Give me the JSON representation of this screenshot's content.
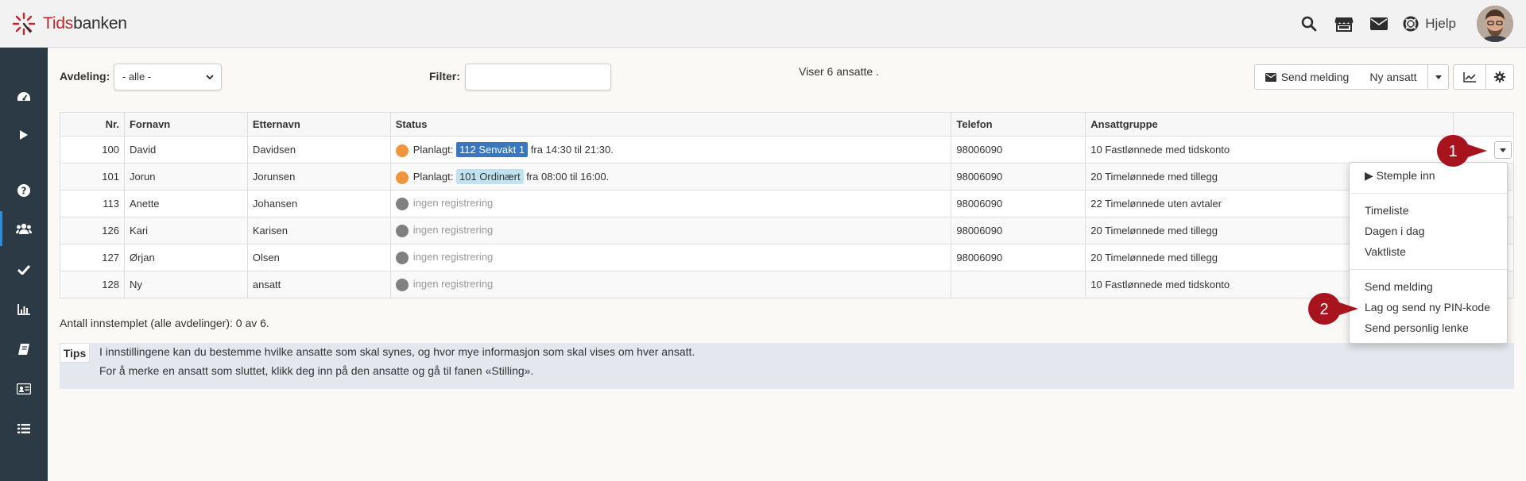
{
  "app": {
    "logo_part1": "Tids",
    "logo_part2": "banken",
    "help_label": "Hjelp"
  },
  "sidebar": {
    "items": [
      "dashboard-icon",
      "play-icon",
      "question-icon",
      "users-icon",
      "check-icon",
      "chart-icon",
      "book-icon",
      "id-card-icon",
      "list-icon"
    ],
    "active_index": 3
  },
  "filters": {
    "department_label": "Avdeling:",
    "department_value": "- alle -",
    "filter_label": "Filter:",
    "filter_value": "",
    "count_text": "Viser 6 ansatte ."
  },
  "toolbar": {
    "send_message": "Send melding",
    "new_employee": "Ny ansatt"
  },
  "table": {
    "headers": [
      "Nr.",
      "Fornavn",
      "Etternavn",
      "Status",
      "Telefon",
      "Ansattgruppe"
    ],
    "rows": [
      {
        "nr": "100",
        "first": "David",
        "last": "Davidsen",
        "status_type": "planned",
        "status_prefix": "Planlagt:",
        "shift": "112 Senvakt 1",
        "shift_style": "dark",
        "status_suffix": "fra 14:30 til 21:30.",
        "phone": "98006090",
        "group": "10 Fastlønnede med tidskonto"
      },
      {
        "nr": "101",
        "first": "Jorun",
        "last": "Jorunsen",
        "status_type": "planned",
        "status_prefix": "Planlagt:",
        "shift": "101 Ordinært",
        "shift_style": "light",
        "status_suffix": "fra 08:00 til 16:00.",
        "phone": "98006090",
        "group": "20 Timelønnede med tillegg"
      },
      {
        "nr": "113",
        "first": "Anette",
        "last": "Johansen",
        "status_type": "none",
        "status_text": "ingen registrering",
        "phone": "98006090",
        "group": "22 Timelønnede uten avtaler"
      },
      {
        "nr": "126",
        "first": "Kari",
        "last": "Karisen",
        "status_type": "none",
        "status_text": "ingen registrering",
        "phone": "98006090",
        "group": "20 Timelønnede med tillegg"
      },
      {
        "nr": "127",
        "first": "Ørjan",
        "last": "Olsen",
        "status_type": "none",
        "status_text": "ingen registrering",
        "phone": "98006090",
        "group": "20 Timelønnede med tillegg"
      },
      {
        "nr": "128",
        "first": "Ny",
        "last": "ansatt",
        "status_type": "none",
        "status_text": "ingen registrering",
        "phone": "",
        "group": "10 Fastlønnede med tidskonto"
      }
    ]
  },
  "summary": "Antall innstemplet (alle avdelinger): 0 av 6.",
  "dropdown": {
    "stamp_in": "▶ Stemple inn",
    "timesheet": "Timeliste",
    "today": "Dagen i dag",
    "shift_list": "Vaktliste",
    "send_message": "Send melding",
    "new_pin": "Lag og send ny PIN-kode",
    "personal_link": "Send personlig lenke"
  },
  "markers": {
    "one": "1",
    "two": "2"
  },
  "tips": {
    "label": "Tips",
    "line1": "I innstillingene kan du bestemme hvilke ansatte som skal synes, og hvor mye informasjon som skal vises om hver ansatt.",
    "line2": "For å merke en ansatt som sluttet, klikk deg inn på den ansatte og gå til fanen «Stilling»."
  },
  "colors": {
    "accent": "#2e8bd6",
    "sidebar": "#2b3a44",
    "marker": "#a8141e",
    "shift_dark": "#3577c0",
    "shift_light": "#bfe3f1",
    "status_orange": "#f0953e"
  }
}
